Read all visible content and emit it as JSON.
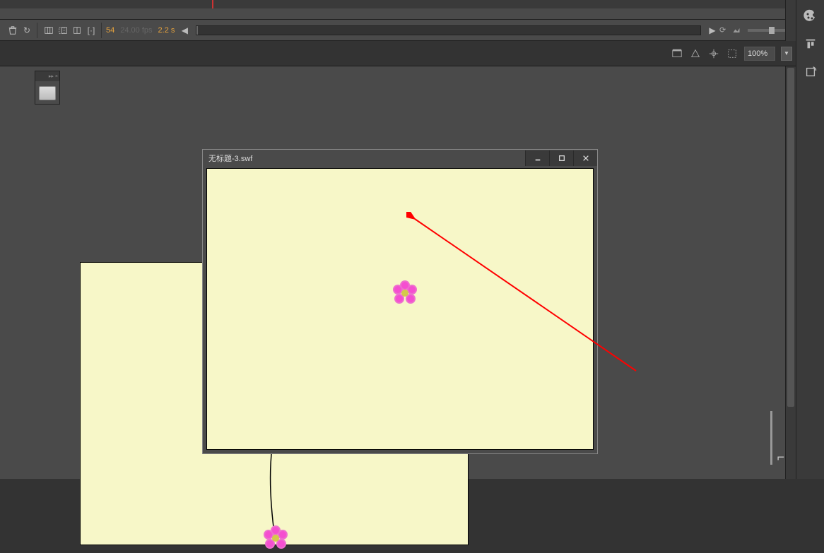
{
  "timeline": {
    "frame_number": "54",
    "fps": "24.00 fps",
    "time": "2.2 s"
  },
  "zoom": {
    "value": "100%"
  },
  "swf_window": {
    "title": "无标题-3.swf",
    "minimize": "—",
    "maximize": "☐",
    "close": "×"
  },
  "icons": {
    "palette": "🎨",
    "align": "≡",
    "rotate": "⟳"
  }
}
